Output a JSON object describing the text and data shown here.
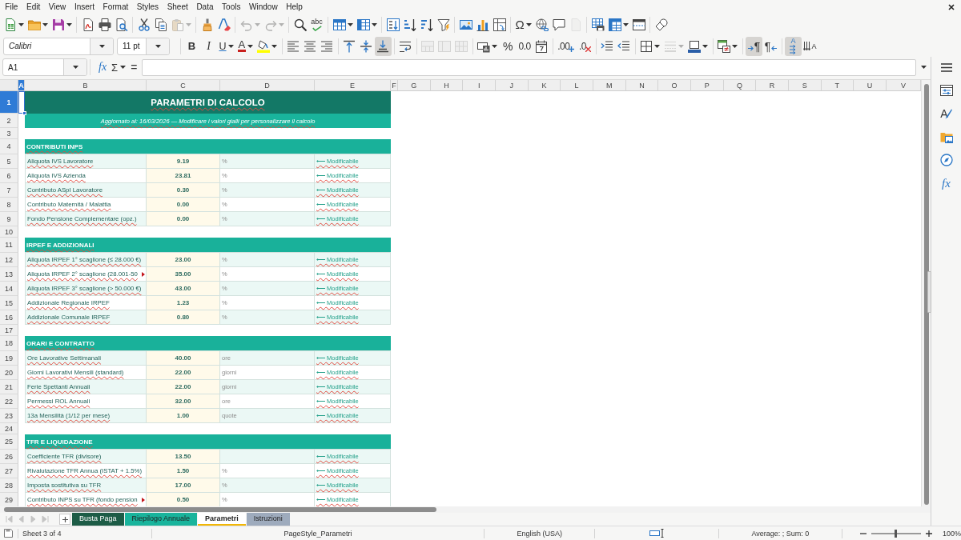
{
  "menu_bar": [
    "File",
    "Edit",
    "View",
    "Insert",
    "Format",
    "Styles",
    "Sheet",
    "Data",
    "Tools",
    "Window",
    "Help"
  ],
  "standard_toolbar": [
    [
      {
        "kind": "new",
        "dropdown": true,
        "disabled": false
      },
      {
        "kind": "open",
        "dropdown": true,
        "disabled": false
      },
      {
        "kind": "save",
        "dropdown": true,
        "disabled": false
      }
    ],
    [
      {
        "kind": "exportpdf",
        "dropdown": false,
        "disabled": false
      },
      {
        "kind": "print",
        "dropdown": false,
        "disabled": false
      },
      {
        "kind": "preview",
        "dropdown": false,
        "disabled": false
      }
    ],
    [
      {
        "kind": "cut",
        "dropdown": false,
        "disabled": false
      },
      {
        "kind": "copy",
        "dropdown": false,
        "disabled": false
      },
      {
        "kind": "paste",
        "dropdown": true,
        "disabled": true
      }
    ],
    [
      {
        "kind": "clone",
        "dropdown": false,
        "disabled": false
      },
      {
        "kind": "clear",
        "dropdown": false,
        "disabled": false
      }
    ],
    [
      {
        "kind": "undo",
        "dropdown": true,
        "disabled": true
      },
      {
        "kind": "redo",
        "dropdown": true,
        "disabled": true
      }
    ],
    [
      {
        "kind": "find",
        "dropdown": false,
        "disabled": false
      },
      {
        "kind": "spelling",
        "glyph": "abc",
        "dropdown": false,
        "disabled": false
      }
    ],
    [
      {
        "kind": "rows",
        "dropdown": true,
        "disabled": false
      },
      {
        "kind": "columns",
        "dropdown": true,
        "disabled": false
      }
    ],
    [
      {
        "kind": "sort",
        "dropdown": false,
        "disabled": false
      },
      {
        "kind": "sortasc",
        "dropdown": false,
        "disabled": false
      },
      {
        "kind": "sortdesc",
        "dropdown": false,
        "disabled": false
      },
      {
        "kind": "autofilter",
        "dropdown": false,
        "disabled": false
      }
    ],
    [
      {
        "kind": "image",
        "dropdown": false,
        "disabled": false
      },
      {
        "kind": "chart",
        "dropdown": false,
        "disabled": false
      },
      {
        "kind": "pivot",
        "dropdown": false,
        "disabled": false
      }
    ],
    [
      {
        "kind": "specialchar",
        "glyph": "Ω",
        "dropdown": true,
        "disabled": false
      },
      {
        "kind": "hyperlink",
        "dropdown": false,
        "disabled": false
      },
      {
        "kind": "comment",
        "dropdown": false,
        "disabled": false
      },
      {
        "kind": "headerfooter",
        "dropdown": false,
        "disabled": true
      }
    ],
    [
      {
        "kind": "printarea",
        "dropdown": false,
        "disabled": false
      },
      {
        "kind": "freeze",
        "dropdown": true,
        "disabled": false
      },
      {
        "kind": "split",
        "dropdown": false,
        "disabled": false
      }
    ],
    [
      {
        "kind": "draw",
        "dropdown": false,
        "disabled": false
      }
    ]
  ],
  "formatting_toolbar": {
    "font_name": "Calibri",
    "font_size": "11 pt",
    "groups": [
      [
        {
          "kind": "bold",
          "glyph": "B",
          "dropdown": false,
          "disabled": false,
          "pressed": false
        },
        {
          "kind": "italic",
          "glyph": "I",
          "dropdown": false,
          "disabled": false,
          "pressed": false
        },
        {
          "kind": "underline",
          "glyph": "U",
          "dropdown": true,
          "disabled": false,
          "pressed": false
        },
        {
          "kind": "fontcolor",
          "glyph": "A",
          "dropdown": true,
          "disabled": false,
          "pressed": false
        },
        {
          "kind": "highlight",
          "dropdown": true,
          "disabled": false,
          "pressed": false
        }
      ],
      [
        {
          "kind": "alignleft",
          "dropdown": false,
          "disabled": false,
          "pressed": false
        },
        {
          "kind": "aligncenter",
          "dropdown": false,
          "disabled": false,
          "pressed": false
        },
        {
          "kind": "alignright",
          "dropdown": false,
          "disabled": false,
          "pressed": false
        }
      ],
      [
        {
          "kind": "aligntop",
          "dropdown": false,
          "disabled": false,
          "pressed": false
        },
        {
          "kind": "alignmiddle",
          "dropdown": false,
          "disabled": false,
          "pressed": false
        },
        {
          "kind": "alignbottom",
          "dropdown": false,
          "disabled": false,
          "pressed": true
        }
      ],
      [
        {
          "kind": "wrap",
          "dropdown": false,
          "disabled": false,
          "pressed": false
        }
      ],
      [
        {
          "kind": "mergecenter",
          "dropdown": false,
          "disabled": true,
          "pressed": false
        },
        {
          "kind": "merge",
          "dropdown": false,
          "disabled": true,
          "pressed": false
        },
        {
          "kind": "unmerge",
          "dropdown": false,
          "disabled": true,
          "pressed": false
        }
      ],
      [
        {
          "kind": "numberformat",
          "dropdown": true,
          "disabled": false,
          "pressed": false
        },
        {
          "kind": "percent",
          "glyph": "%",
          "dropdown": false,
          "disabled": false,
          "pressed": false
        },
        {
          "kind": "standard",
          "glyph": "0.0",
          "dropdown": false,
          "disabled": false,
          "pressed": false
        },
        {
          "kind": "date",
          "dropdown": false,
          "disabled": false,
          "pressed": false
        }
      ],
      [
        {
          "kind": "adddecimal",
          "glyph": ".00",
          "dropdown": false,
          "disabled": false,
          "pressed": false
        },
        {
          "kind": "deletedecimal",
          "glyph": ".0",
          "dropdown": false,
          "disabled": false,
          "pressed": false
        }
      ],
      [
        {
          "kind": "indent",
          "dropdown": false,
          "disabled": false,
          "pressed": false
        },
        {
          "kind": "outdent",
          "dropdown": false,
          "disabled": false,
          "pressed": false
        }
      ],
      [
        {
          "kind": "borders",
          "dropdown": true,
          "disabled": false,
          "pressed": false
        },
        {
          "kind": "borderstyle",
          "dropdown": true,
          "disabled": true,
          "pressed": false
        },
        {
          "kind": "bordercolor",
          "dropdown": true,
          "disabled": false,
          "pressed": false
        }
      ],
      [
        {
          "kind": "conditional",
          "dropdown": true,
          "disabled": false,
          "pressed": false
        }
      ],
      [
        {
          "kind": "ltr",
          "glyph": "¶",
          "dropdown": false,
          "disabled": false,
          "pressed": true
        },
        {
          "kind": "rtl",
          "glyph": "¶",
          "dropdown": false,
          "disabled": false,
          "pressed": false
        }
      ],
      [
        {
          "kind": "horizontal",
          "glyph": "A",
          "dropdown": false,
          "disabled": false,
          "pressed": true
        },
        {
          "kind": "vertical",
          "glyph": "A",
          "dropdown": false,
          "disabled": false,
          "pressed": false
        }
      ]
    ]
  },
  "formula_bar": {
    "name_box": "A1",
    "function_wizard_button": "fx",
    "sum_button": "Σ",
    "formula_button": "="
  },
  "sheet": {
    "columns": [
      {
        "label": "A",
        "selected": true
      },
      {
        "label": "B",
        "selected": false
      },
      {
        "label": "C",
        "selected": false
      },
      {
        "label": "D",
        "selected": false
      },
      {
        "label": "E",
        "selected": false
      },
      {
        "label": "F",
        "selected": false
      },
      {
        "label": "G",
        "selected": false
      },
      {
        "label": "H",
        "selected": false
      },
      {
        "label": "I",
        "selected": false
      },
      {
        "label": "J",
        "selected": false
      },
      {
        "label": "K",
        "selected": false
      },
      {
        "label": "L",
        "selected": false
      },
      {
        "label": "M",
        "selected": false
      },
      {
        "label": "N",
        "selected": false
      },
      {
        "label": "O",
        "selected": false
      },
      {
        "label": "P",
        "selected": false
      },
      {
        "label": "Q",
        "selected": false
      },
      {
        "label": "R",
        "selected": false
      },
      {
        "label": "S",
        "selected": false
      },
      {
        "label": "T",
        "selected": false
      },
      {
        "label": "U",
        "selected": false
      },
      {
        "label": "V",
        "selected": false
      }
    ],
    "rows": [
      {
        "number": "1",
        "selected": true,
        "kind": "title",
        "text": "PARAMETRI DI CALCOLO"
      },
      {
        "number": "2",
        "selected": false,
        "kind": "subtitle",
        "text": "Aggiornato al: 16/03/2026 — Modificare i valori gialli per personalizzare il calcolo"
      },
      {
        "number": "3",
        "selected": false,
        "kind": "blank"
      },
      {
        "number": "4",
        "selected": false,
        "kind": "section",
        "text": "CONTRIBUTI INPS"
      },
      {
        "number": "5",
        "selected": false,
        "kind": "param",
        "label": "Aliquota IVS Lavoratore",
        "clipped": false,
        "value": "9.19",
        "unit": "%",
        "note": "⟵ Modificabile"
      },
      {
        "number": "6",
        "selected": false,
        "kind": "param",
        "label": "Aliquota IVS Azienda",
        "clipped": false,
        "value": "23.81",
        "unit": "%",
        "note": "⟵ Modificabile"
      },
      {
        "number": "7",
        "selected": false,
        "kind": "param",
        "label": "Contributo ASpI Lavoratore",
        "clipped": false,
        "value": "0.30",
        "unit": "%",
        "note": "⟵ Modificabile"
      },
      {
        "number": "8",
        "selected": false,
        "kind": "param",
        "label": "Contributo Maternità / Malattia",
        "clipped": false,
        "value": "0.00",
        "unit": "%",
        "note": "⟵ Modificabile"
      },
      {
        "number": "9",
        "selected": false,
        "kind": "param",
        "label": "Fondo Pensione Complementare (opz.)",
        "clipped": false,
        "value": "0.00",
        "unit": "%",
        "note": "⟵ Modificabile"
      },
      {
        "number": "10",
        "selected": false,
        "kind": "blank"
      },
      {
        "number": "11",
        "selected": false,
        "kind": "section",
        "text": "IRPEF E ADDIZIONALI"
      },
      {
        "number": "12",
        "selected": false,
        "kind": "param",
        "label": "Aliquota IRPEF 1° scaglione (≤ 28.000 €)",
        "clipped": false,
        "value": "23.00",
        "unit": "%",
        "note": "⟵ Modificabile"
      },
      {
        "number": "13",
        "selected": false,
        "kind": "param",
        "label": "Aliquota IRPEF 2° scaglione (28.001-50",
        "clipped": true,
        "value": "35.00",
        "unit": "%",
        "note": "⟵ Modificabile"
      },
      {
        "number": "14",
        "selected": false,
        "kind": "param",
        "label": "Aliquota IRPEF 3° scaglione (> 50.000 €)",
        "clipped": false,
        "value": "43.00",
        "unit": "%",
        "note": "⟵ Modificabile"
      },
      {
        "number": "15",
        "selected": false,
        "kind": "param",
        "label": "Addizionale Regionale IRPEF",
        "clipped": false,
        "value": "1.23",
        "unit": "%",
        "note": "⟵ Modificabile"
      },
      {
        "number": "16",
        "selected": false,
        "kind": "param",
        "label": "Addizionale Comunale IRPEF",
        "clipped": false,
        "value": "0.80",
        "unit": "%",
        "note": "⟵ Modificabile"
      },
      {
        "number": "17",
        "selected": false,
        "kind": "blank"
      },
      {
        "number": "18",
        "selected": false,
        "kind": "section",
        "text": "ORARI E CONTRATTO"
      },
      {
        "number": "19",
        "selected": false,
        "kind": "param",
        "label": "Ore Lavorative Settimanali",
        "clipped": false,
        "value": "40.00",
        "unit": "ore",
        "note": "⟵ Modificabile"
      },
      {
        "number": "20",
        "selected": false,
        "kind": "param",
        "label": "Giorni Lavorativi Mensili (standard)",
        "clipped": false,
        "value": "22.00",
        "unit": "giorni",
        "note": "⟵ Modificabile"
      },
      {
        "number": "21",
        "selected": false,
        "kind": "param",
        "label": "Ferie Spettanti Annuali",
        "clipped": false,
        "value": "22.00",
        "unit": "giorni",
        "note": "⟵ Modificabile"
      },
      {
        "number": "22",
        "selected": false,
        "kind": "param",
        "label": "Permessi ROL Annuali",
        "clipped": false,
        "value": "32.00",
        "unit": "ore",
        "note": "⟵ Modificabile"
      },
      {
        "number": "23",
        "selected": false,
        "kind": "param",
        "label": "13a Mensilità (1/12 per mese)",
        "clipped": false,
        "value": "1.00",
        "unit": "quote",
        "note": "⟵ Modificabile"
      },
      {
        "number": "24",
        "selected": false,
        "kind": "blank"
      },
      {
        "number": "25",
        "selected": false,
        "kind": "section",
        "text": "TFR E LIQUIDAZIONE"
      },
      {
        "number": "26",
        "selected": false,
        "kind": "param",
        "label": "Coefficiente TFR (divisore)",
        "clipped": false,
        "value": "13.50",
        "note": "⟵ Modificabile"
      },
      {
        "number": "27",
        "selected": false,
        "kind": "param",
        "label": "Rivalutazione TFR Annua (ISTAT + 1.5%)",
        "clipped": false,
        "value": "1.50",
        "unit": "%",
        "note": "⟵ Modificabile"
      },
      {
        "number": "28",
        "selected": false,
        "kind": "param",
        "label": "Imposta sostitutiva su TFR",
        "clipped": false,
        "value": "17.00",
        "unit": "%",
        "note": "⟵ Modificabile"
      },
      {
        "number": "29",
        "selected": false,
        "kind": "param",
        "label": "Contributo INPS su TFR (fondo pension",
        "clipped": true,
        "value": "0.50",
        "unit": "%",
        "note": "⟵ Modificabile"
      }
    ]
  },
  "sidebar": [
    {
      "kind": "properties",
      "selected": false
    },
    {
      "kind": "styles",
      "glyph": "A",
      "selected": false
    },
    {
      "kind": "gallery",
      "selected": false
    },
    {
      "kind": "navigator",
      "selected": false
    },
    {
      "kind": "functions",
      "glyph": "fx",
      "selected": false
    }
  ],
  "sheet_navigation": [
    {
      "kind": "first",
      "disabled": true
    },
    {
      "kind": "previous",
      "disabled": true
    },
    {
      "kind": "next",
      "disabled": true
    },
    {
      "kind": "last",
      "disabled": true
    }
  ],
  "sheet_tabs": [
    {
      "label": "Busta Paga",
      "color": "#1d5c46",
      "selected": false
    },
    {
      "label": "Riepilogo Annuale",
      "color": "#19b49c",
      "selected": false
    },
    {
      "label": "Parametri",
      "color": "#f2b705",
      "selected": true
    },
    {
      "label": "Istruzioni",
      "color": "#9eabbd",
      "selected": false
    }
  ],
  "status_bar": {
    "sheet_position": "Sheet 3 of 4",
    "page_style": "PageStyle_Parametri",
    "language": "English (USA)",
    "summary": "Average: ; Sum: 0",
    "zoom": {
      "level": 0.5,
      "reading": "100%"
    }
  }
}
